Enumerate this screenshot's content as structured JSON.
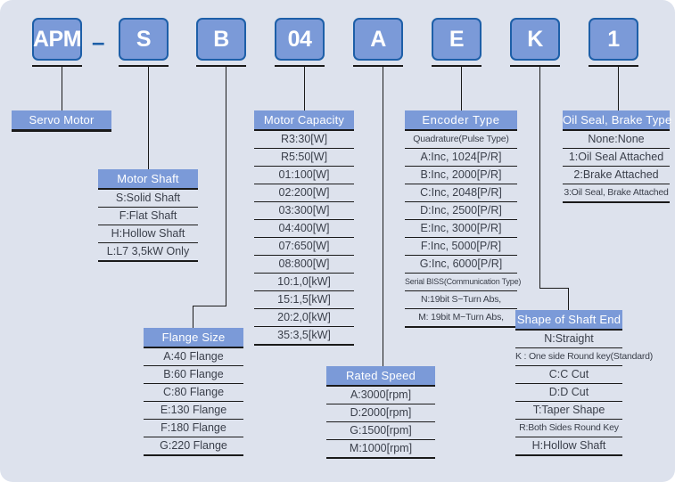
{
  "diagram": {
    "title": "APM Servo Motor Model Designation",
    "separator": "–",
    "colors": {
      "background": "#dde2ed",
      "box_fill": "#7b9ad8",
      "box_border": "#1d5fa8",
      "line": "#1a1a1a",
      "text": "#3a3f4a",
      "title_text": "#ffffff"
    }
  },
  "code_boxes": [
    {
      "id": "series",
      "label": "APM"
    },
    {
      "id": "motor-shaft",
      "label": "S"
    },
    {
      "id": "flange-size",
      "label": "B"
    },
    {
      "id": "motor-capacity",
      "label": "04"
    },
    {
      "id": "rated-speed",
      "label": "A"
    },
    {
      "id": "encoder-type",
      "label": "E"
    },
    {
      "id": "shaft-end",
      "label": "K"
    },
    {
      "id": "oil-seal",
      "label": "1"
    }
  ],
  "legends": {
    "servo_motor": {
      "title": "Servo Motor",
      "rows": []
    },
    "motor_shaft": {
      "title": "Motor Shaft",
      "rows": [
        "S:Solid Shaft",
        "F:Flat Shaft",
        "H:Hollow Shaft",
        "L:L7 3,5kW Only"
      ]
    },
    "flange_size": {
      "title": "Flange Size",
      "rows": [
        "A:40 Flange",
        "B:60 Flange",
        "C:80 Flange",
        "E:130 Flange",
        "F:180 Flange",
        "G:220 Flange"
      ]
    },
    "motor_capacity": {
      "title": "Motor Capacity",
      "rows": [
        "R3:30[W]",
        "R5:50[W]",
        "01:100[W]",
        "02:200[W]",
        "03:300[W]",
        "04:400[W]",
        "07:650[W]",
        "08:800[W]",
        "10:1,0[kW]",
        "15:1,5[kW]",
        "20:2,0[kW]",
        "35:3,5[kW]"
      ]
    },
    "rated_speed": {
      "title": "Rated Speed",
      "rows": [
        "A:3000[rpm]",
        "D:2000[rpm]",
        "G:1500[rpm]",
        "M:1000[rpm]"
      ]
    },
    "encoder_type": {
      "title": "Encoder  Type",
      "rows": [
        "Quadrature(Pulse Type)",
        "A:Inc, 1024[P/R]",
        "B:Inc, 2000[P/R]",
        "C:Inc, 2048[P/R]",
        "D:Inc, 2500[P/R]",
        "E:Inc, 3000[P/R]",
        "F:Inc, 5000[P/R]",
        "G:Inc, 6000[P/R]",
        "Serial BISS(Communication Type)",
        "N:19bit S−Turn Abs,",
        "M: 19bit M−Turn Abs,"
      ],
      "small_rows": [
        0,
        8,
        9,
        10
      ]
    },
    "shaft_end": {
      "title": "Shape of Shaft End",
      "rows": [
        "N:Straight",
        "K : One side Round key(Standard)",
        "C:C Cut",
        "D:D Cut",
        "T:Taper Shape",
        "R:Both Sides Round Key",
        "H:Hollow Shaft"
      ],
      "small_rows": [
        1,
        5
      ]
    },
    "oil_seal": {
      "title": "Oil Seal, Brake Type",
      "rows": [
        "None:None",
        "1:Oil Seal Attached",
        "2:Brake  Attached",
        "3:Oil Seal, Brake Attached"
      ],
      "small_rows": [
        3
      ]
    }
  }
}
